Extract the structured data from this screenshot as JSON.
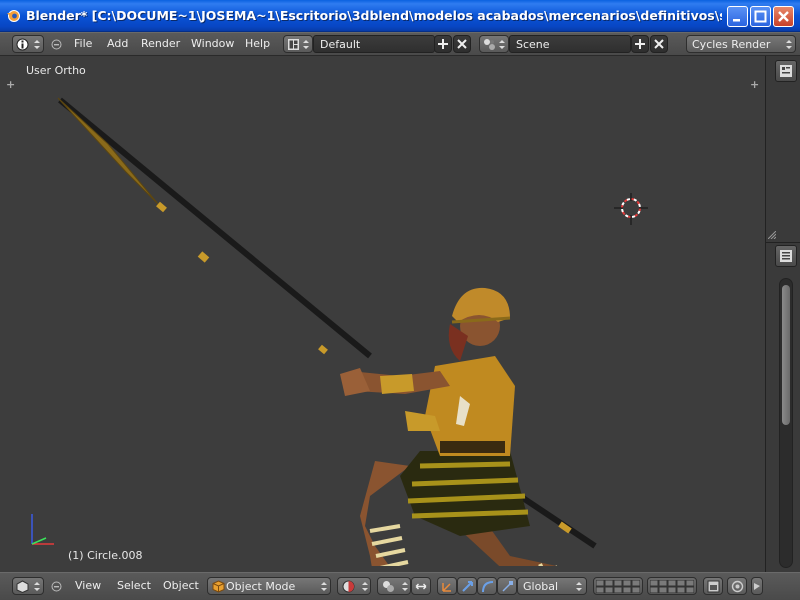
{
  "window": {
    "title": "Blender* [C:\\DOCUME~1\\JOSEMA~1\\Escritorio\\3dblend\\modelos acabados\\mercenarios\\definitivos\\she wolves l..."
  },
  "top_header": {
    "menus": [
      "File",
      "Add",
      "Render",
      "Window",
      "Help"
    ],
    "screen_layout": "Default",
    "scene": "Scene",
    "render_engine": "Cycles Render"
  },
  "viewport": {
    "view_label": "User Ortho",
    "object_label": "(1) Circle.008"
  },
  "bottom_header": {
    "menus": [
      "View",
      "Select",
      "Object"
    ],
    "mode": "Object Mode",
    "orientation": "Global"
  },
  "colors": {
    "viewport_bg": "#3d3d3d",
    "header_bg": "#4f4f4f",
    "titlebar_blue": "#0a54d6",
    "cursor_red": "#e33b3b"
  },
  "icons": {
    "info": "info-icon",
    "screen": "screen-layout-icon",
    "scene": "scene-icon",
    "view3d": "3d-view-icon",
    "mode": "cube-icon",
    "shading": "shading-icon",
    "pivot": "pivot-icon",
    "manipulator": "manipulator-icon",
    "translate": "translate-icon",
    "rotate": "rotate-icon",
    "scale": "scale-icon",
    "layers": "layers-icon",
    "snap": "snap-icon",
    "proportional": "proportional-edit-icon"
  }
}
